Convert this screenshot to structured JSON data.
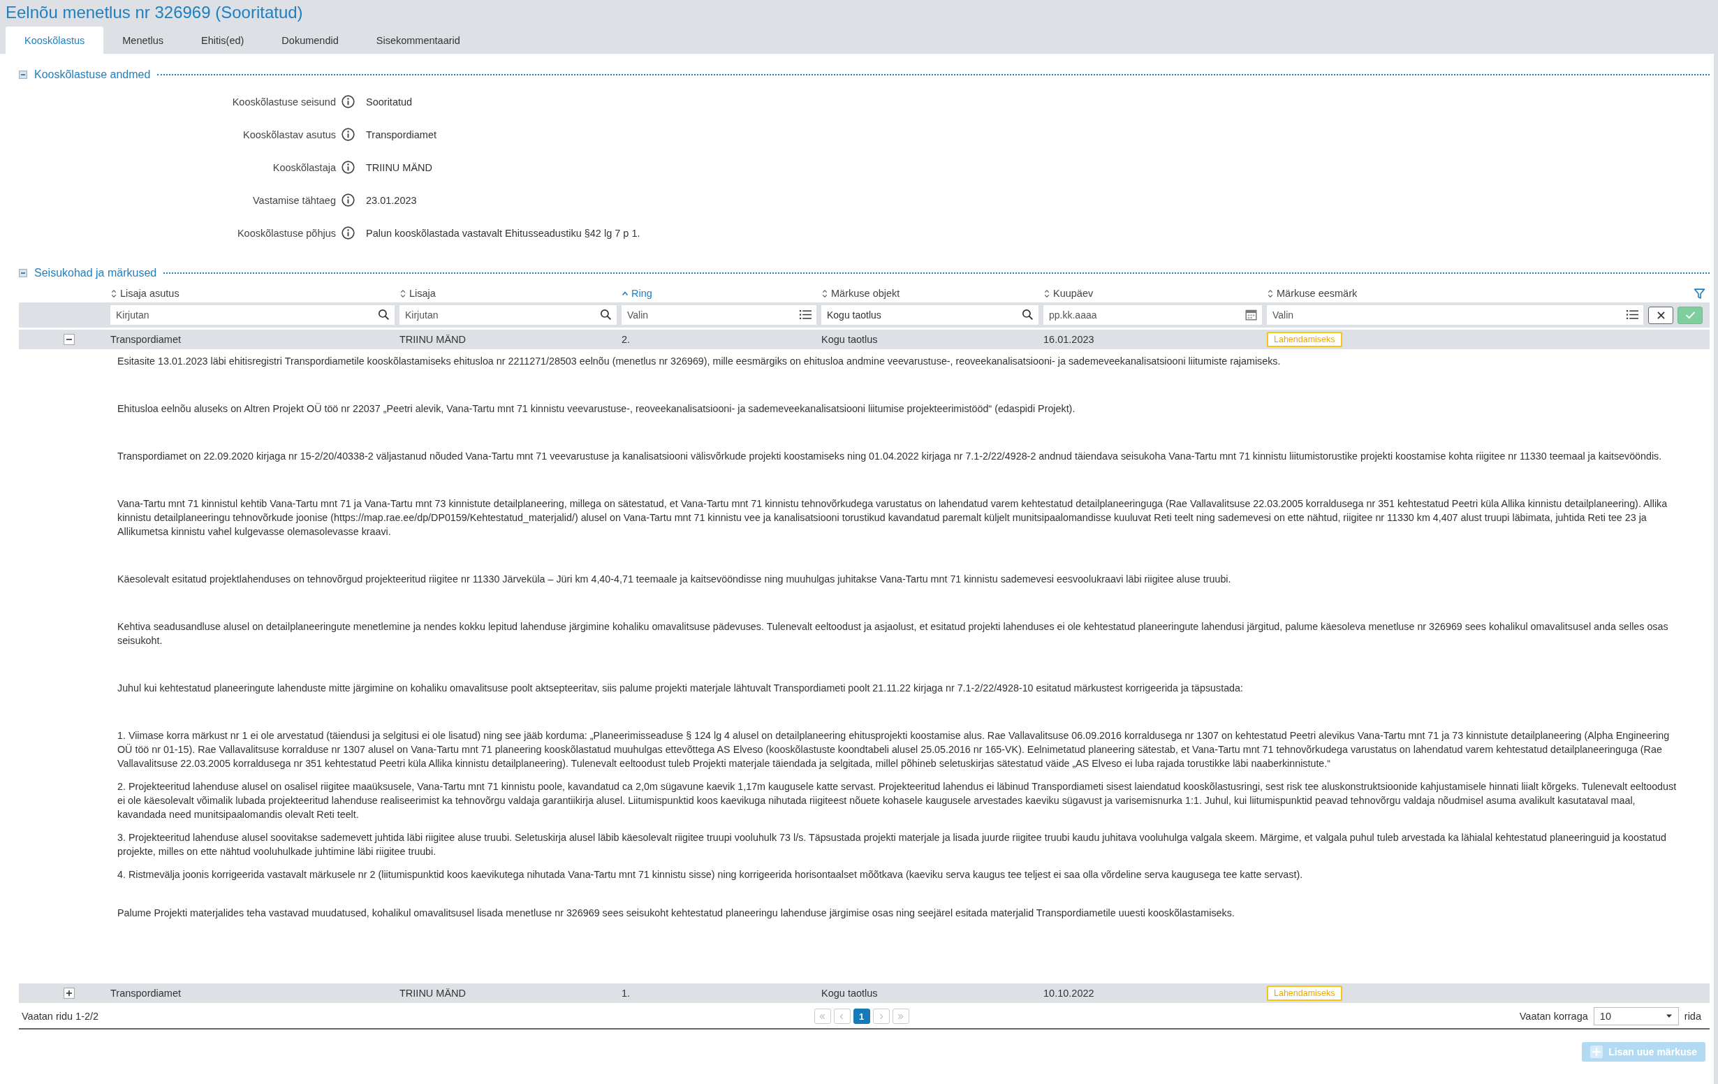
{
  "title": "Eelnõu menetlus nr 326969 (Sooritatud)",
  "tabs": [
    {
      "label": "Kooskõlastus",
      "selected": true
    },
    {
      "label": "Menetlus",
      "selected": false
    },
    {
      "label": "Ehitis(ed)",
      "selected": false
    },
    {
      "label": "Dokumendid",
      "selected": false
    },
    {
      "label": "Sisekommentaarid",
      "selected": false
    }
  ],
  "details": {
    "title": "Kooskõlastuse andmed",
    "expanded": true,
    "fields": [
      {
        "label": "Kooskõlastuse seisund",
        "value": "Sooritatud"
      },
      {
        "label": "Kooskõlastav asutus",
        "value": "Transpordiamet"
      },
      {
        "label": "Kooskõlastaja",
        "value": "TRIINU MÄND"
      },
      {
        "label": "Vastamise tähtaeg",
        "value": "23.01.2023"
      },
      {
        "label": "Kooskõlastuse põhjus",
        "value": "Palun kooskõlastada vastavalt Ehitusseadustiku §42 lg 7 p 1."
      }
    ]
  },
  "remarks": {
    "title": "Seisukohad ja märkused",
    "expanded": true,
    "columns": [
      {
        "label": "Lisaja asutus",
        "sorted": false
      },
      {
        "label": "Lisaja",
        "sorted": false
      },
      {
        "label": "Ring",
        "sorted": true
      },
      {
        "label": "Märkuse objekt",
        "sorted": false
      },
      {
        "label": "Kuupäev",
        "sorted": false
      },
      {
        "label": "Märkuse eesmärk",
        "sorted": false
      }
    ],
    "filters": [
      {
        "kind": "search",
        "placeholder": "Kirjutan"
      },
      {
        "kind": "search",
        "placeholder": "Kirjutan"
      },
      {
        "kind": "list",
        "placeholder": "Valin"
      },
      {
        "kind": "search",
        "value": "Kogu taotlus"
      },
      {
        "kind": "date",
        "placeholder": "pp.kk.aaaa"
      },
      {
        "kind": "list",
        "placeholder": "Valin"
      }
    ],
    "rows": [
      {
        "expanded": true,
        "cells": [
          "Transpordiamet",
          "TRIINU MÄND",
          "2.",
          "Kogu taotlus",
          "16.01.2023"
        ],
        "status": "Lahendamiseks",
        "paragraphs": [
          {
            "kind": "paragraph",
            "text": "Esitasite 13.01.2023 läbi ehitisregistri Transpordiametile kooskõlastamiseks ehitusloa nr 2211271/28503 eelnõu (menetlus nr 326969), mille eesmärgiks on ehitusloa andmine veevarustuse-, reoveekanalisatsiooni- ja sademeveekanalisatsiooni liitumiste rajamiseks."
          },
          {
            "kind": "paragraph",
            "text": "Ehitusloa eelnõu aluseks on Altren Projekt OÜ töö nr 22037 „Peetri alevik, Vana-Tartu mnt 71 kinnistu veevarustuse-, reoveekanalisatsiooni- ja sademeveekanalisatsiooni liitumise projekteerimistööd“ (edaspidi Projekt)."
          },
          {
            "kind": "paragraph",
            "text": "Transpordiamet on 22.09.2020 kirjaga nr 15-2/20/40338-2 väljastanud nõuded Vana-Tartu mnt 71 veevarustuse ja kanalisatsiooni välisvõrkude projekti koostamiseks ning 01.04.2022 kirjaga nr 7.1-2/22/4928-2 andnud täiendava seisukoha Vana-Tartu mnt 71 kinnistu liitumistorustike projekti koostamise kohta riigitee nr 11330 teemaal ja kaitsevööndis."
          },
          {
            "kind": "paragraph",
            "text": "Vana-Tartu mnt 71 kinnistul kehtib Vana-Tartu mnt 71 ja Vana-Tartu mnt 73 kinnistute detailplaneering, millega on sätestatud, et Vana-Tartu mnt 71 kinnistu tehnovõrkudega varustatus on lahendatud varem kehtestatud detailplaneeringuga (Rae Vallavalitsuse 22.03.2005 korraldusega nr 351 kehtestatud Peetri küla Allika kinnistu detailplaneering). Allika kinnistu detailplaneeringu tehnovõrkude joonise (https://map.rae.ee/dp/DP0159/Kehtestatud_materjalid/) alusel on Vana-Tartu mnt 71 kinnistu vee ja kanalisatsiooni torustikud kavandatud paremalt küljelt munitsipaalomandisse kuuluvat Reti teelt ning sademevesi on ette nähtud, riigitee nr 11330 km 4,407 alust truupi läbimata, juhtida Reti tee 23 ja Allikumetsa kinnistu vahel kulgevasse olemasolevasse kraavi."
          },
          {
            "kind": "paragraph",
            "text": "Käesolevalt esitatud projektlahenduses on tehnovõrgud projekteeritud riigitee nr 11330 Järveküla – Jüri km 4,40-4,71 teemaale ja kaitsevööndisse ning muuhulgas juhitakse Vana-Tartu mnt 71 kinnistu sademevesi eesvoolukraavi läbi riigitee aluse truubi."
          },
          {
            "kind": "paragraph",
            "text": "Kehtiva seadusandluse alusel on detailplaneeringute menetlemine ja nendes kokku lepitud lahenduse järgimine kohaliku omavalitsuse pädevuses. Tulenevalt eeltoodust ja asjaolust, et esitatud projekti lahenduses ei ole kehtestatud planeeringute lahendusi järgitud, palume käesoleva menetluse nr 326969 sees kohalikul omavalitsusel anda selles osas seisukoht."
          },
          {
            "kind": "paragraph",
            "text": "Juhul kui kehtestatud planeeringute lahenduste mitte järgimine on kohaliku omavalitsuse poolt aktsepteeritav, siis palume projekti materjale lähtuvalt Transpordiameti poolt 21.11.22 kirjaga nr 7.1-2/22/4928-10 esitatud märkustest korrigeerida ja täpsustada:"
          },
          {
            "kind": "item",
            "text": "1. Viimase korra märkust nr 1 ei ole arvestatud (täiendusi ja selgitusi ei ole lisatud) ning see jääb korduma: „Planeerimisseaduse § 124 lg 4 alusel on detailplaneering ehitusprojekti koostamise alus. Rae Vallavalitsuse 06.09.2016 korraldusega nr 1307 on kehtestatud Peetri alevikus Vana-Tartu mnt 71 ja 73 kinnistute detailplaneering (Alpha Engineering OÜ töö nr 01-15). Rae Vallavalitsuse korralduse nr 1307 alusel on Vana-Tartu mnt 71 planeering kooskõlastatud muuhulgas ettevõttega AS Elveso (kooskõlastuste koondtabeli alusel 25.05.2016 nr 165-VK). Eelnimetatud planeering sätestab, et Vana-Tartu mnt 71 tehnovõrkudega varustatus on lahendatud varem kehtestatud detailplaneeringuga (Rae Vallavalitsuse 22.03.2005 korraldusega nr 351 kehtestatud Peetri küla Allika kinnistu detailplaneering). Tulenevalt eeltoodust tuleb Projekti materjale täiendada ja selgitada, millel põhineb seletuskirjas sätestatud väide „AS Elveso ei luba rajada torustikke läbi naaberkinnistute.“"
          },
          {
            "kind": "item",
            "text": "2. Projekteeritud lahenduse alusel on osalisel riigitee maaüksusele, Vana-Tartu mnt 71 kinnistu poole, kavandatud ca 2,0m sügavune kaevik 1,17m kaugusele katte servast. Projekteeritud lahendus ei läbinud Transpordiameti sisest laiendatud kooskõlastusringi, sest risk tee aluskonstruktsioonide kahjustamisele hinnati liialt kõrgeks. Tulenevalt eeltoodust ei ole käesolevalt võimalik lubada projekteeritud lahenduse realiseerimist ka tehnovõrgu valdaja garantiikirja alusel. Liitumispunktid koos kaevikuga nihutada riigiteest nõuete kohasele kaugusele arvestades kaeviku sügavust ja varisemisnurka 1:1. Juhul, kui liitumispunktid peavad tehnovõrgu valdaja nõudmisel asuma avalikult kasutataval maal, kavandada need munitsipaalomandis olevalt Reti teelt."
          },
          {
            "kind": "item",
            "text": "3. Projekteeritud lahenduse alusel soovitakse sademevett juhtida läbi riigitee aluse truubi. Seletuskirja alusel läbib käesolevalt riigitee truupi vooluhulk 73 l/s. Täpsustada projekti materjale ja lisada juurde riigitee truubi kaudu juhitava vooluhulga valgala skeem. Märgime, et valgala puhul tuleb arvestada ka lähialal kehtestatud planeeringuid ja koostatud projekte, milles on ette nähtud vooluhulkade juhtimine läbi riigitee truubi."
          },
          {
            "kind": "item",
            "text": "4. Ristmevälja joonis korrigeerida vastavalt märkusele nr 2 (liitumispunktid koos kaevikutega nihutada Vana-Tartu mnt 71 kinnistu sisse) ning korrigeerida horisontaalset mõõtkava (kaeviku serva kaugus tee teljest ei saa olla võrdeline serva kaugusega tee katte servast)."
          },
          {
            "kind": "paragraph",
            "text": "Palume Projekti materjalides teha vastavad muudatused, kohalikul omavalitsusel lisada menetluse nr 326969 sees seisukoht kehtestatud planeeringu lahenduse järgimise osas ning seejärel esitada materjalid Transpordiametile uuesti kooskõlastamiseks."
          }
        ]
      },
      {
        "expanded": false,
        "cells": [
          "Transpordiamet",
          "TRIINU MÄND",
          "1.",
          "Kogu taotlus",
          "10.10.2022"
        ],
        "status": "Lahendamiseks",
        "paragraphs": []
      }
    ],
    "pagination": {
      "range_text": "Vaatan ridu 1-2/2",
      "pages": [
        {
          "label": "1",
          "selected": true
        }
      ],
      "per_page_label": "Vaatan korraga",
      "per_page_value": "10",
      "per_page_suffix": "rida"
    },
    "add_button": {
      "label": "Lisan uue märkuse",
      "disabled": true
    }
  }
}
